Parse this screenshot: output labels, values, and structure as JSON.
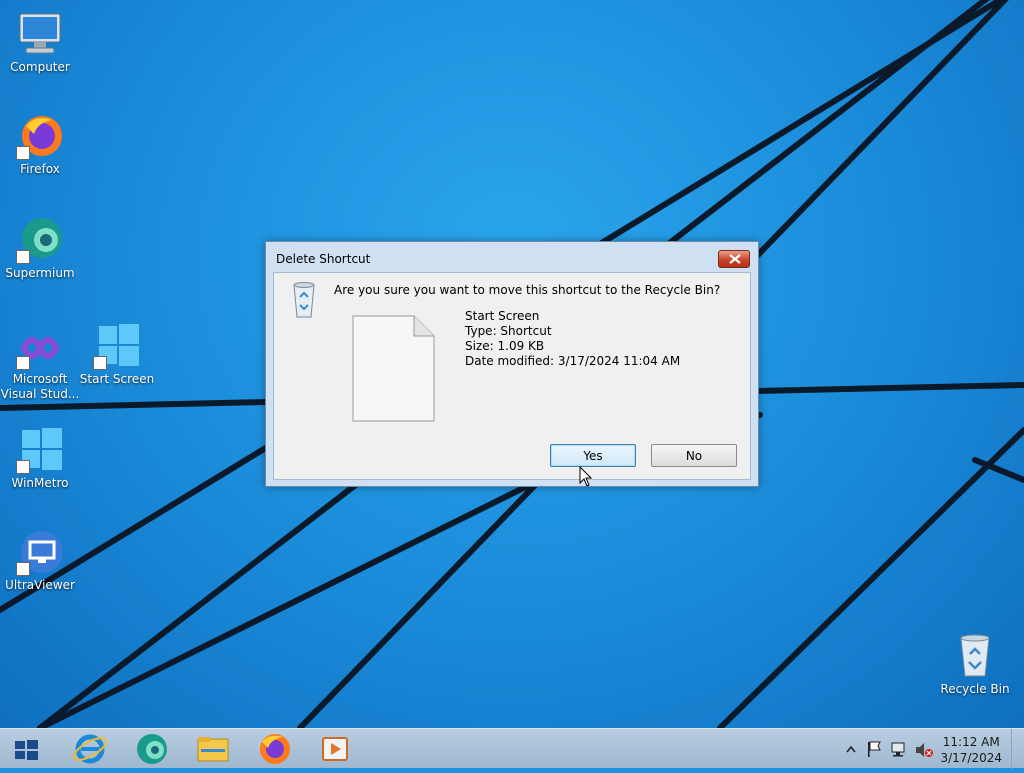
{
  "desktop": {
    "icons": [
      {
        "label": "Computer"
      },
      {
        "label": "Firefox"
      },
      {
        "label": "Supermium"
      },
      {
        "label": "Microsoft Visual Stud..."
      },
      {
        "label": "Start Screen"
      },
      {
        "label": "WinMetro"
      },
      {
        "label": "UltraViewer"
      },
      {
        "label": "Recycle Bin"
      }
    ]
  },
  "dialog": {
    "title": "Delete Shortcut",
    "question": "Are you sure you want to move this shortcut to the Recycle Bin?",
    "file": {
      "name": "Start Screen",
      "type": "Type: Shortcut",
      "size": "Size: 1.09 KB",
      "modified": "Date modified: 3/17/2024 11:04 AM"
    },
    "yes_label": "Yes",
    "no_label": "No"
  },
  "taskbar": {
    "pinned": [
      "internet-explorer-icon",
      "supermium-icon",
      "file-explorer-icon",
      "firefox-icon",
      "media-player-icon"
    ],
    "clock_time": "11:12 AM",
    "clock_date": "3/17/2024"
  },
  "colors": {
    "wallpaper": "#1a8ad8",
    "close_button": "#c9432a",
    "taskbar": "#a9c0d6"
  }
}
